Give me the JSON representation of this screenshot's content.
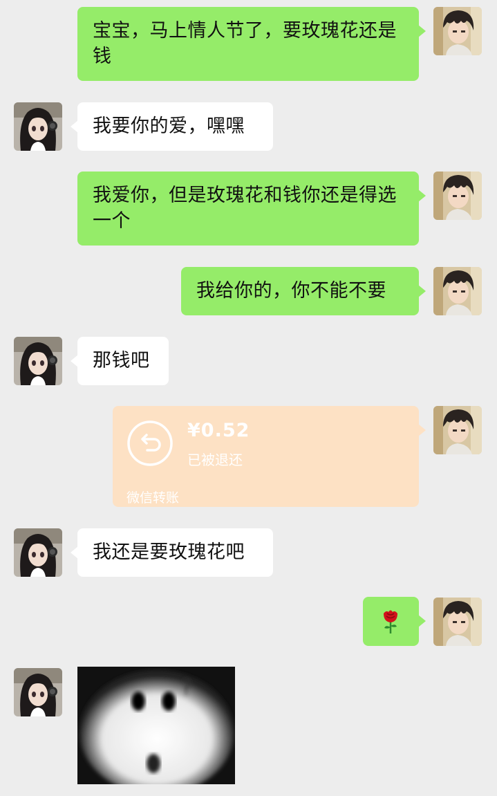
{
  "messages": [
    {
      "side": "right",
      "text": "宝宝，马上情人节了，要玫瑰花还是钱"
    },
    {
      "side": "left",
      "text": "我要你的爱，嘿嘿"
    },
    {
      "side": "right",
      "text": "我爱你，但是玫瑰花和钱你还是得选一个"
    },
    {
      "side": "right",
      "text": "我给你的，你不能不要"
    },
    {
      "side": "left",
      "text": "那钱吧"
    },
    {
      "side": "left",
      "text": "我还是要玫瑰花吧"
    }
  ],
  "transfer": {
    "amount": "¥0.52",
    "status": "已被退还",
    "footer": "微信转账",
    "icon": "return-arrow-icon"
  },
  "rose": {
    "icon": "rose-icon"
  },
  "sticker": {
    "icon": "panda-meme-sticker"
  },
  "colors": {
    "background": "#ededed",
    "sent_bubble": "#95ec69",
    "received_bubble": "#ffffff",
    "transfer_card": "#fde1c4"
  }
}
